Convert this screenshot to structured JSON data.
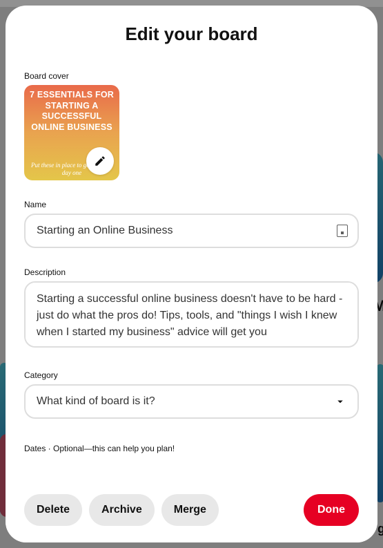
{
  "modal": {
    "title": "Edit your board",
    "labels": {
      "cover": "Board cover",
      "name": "Name",
      "description": "Description",
      "category": "Category",
      "dates": "Dates · Optional—this can help you plan!"
    },
    "cover": {
      "headline": "7 ESSENTIALS FOR STARTING A SUCCESSFUL ONLINE BUSINESS",
      "sub": "Put these in place to go pro from day one"
    },
    "fields": {
      "name": "Starting an Online Business",
      "description": "Starting a successful online business doesn't have to be hard - just do what the pros do! Tips, tools, and \"things I wish I knew when I started my business\" advice will get you",
      "category_placeholder": "What kind of board is it?"
    },
    "footer": {
      "delete": "Delete",
      "archive": "Archive",
      "merge": "Merge",
      "done": "Done"
    }
  },
  "background": {
    "letterM": "M",
    "letterG": "g"
  }
}
